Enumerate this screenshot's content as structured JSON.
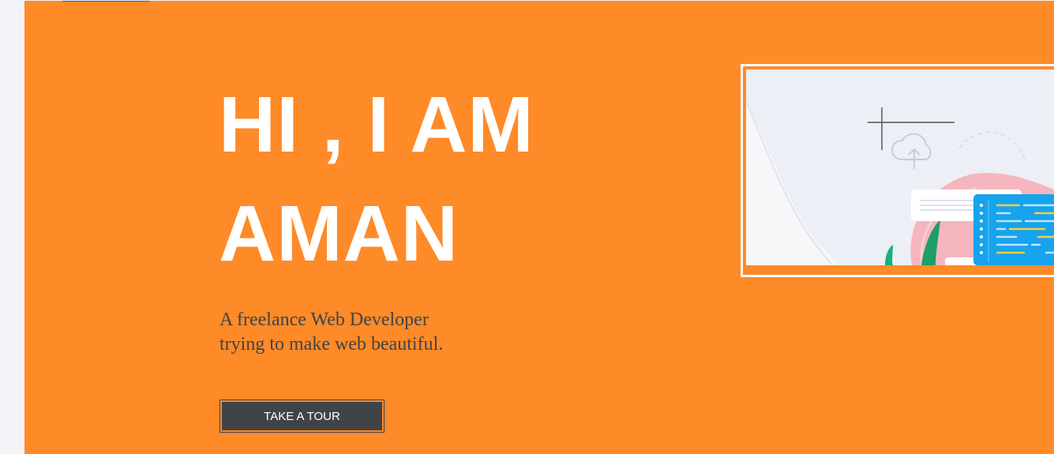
{
  "hero": {
    "headline_line1": "HI , I AM",
    "headline_line2": "AMAN",
    "tagline_line1": "A freelance Web Developer",
    "tagline_line2": "trying to make web beautiful.",
    "cta_label": "TAKE A TOUR"
  },
  "colors": {
    "background": "#fe8a28",
    "headline": "#ffffff",
    "tagline": "#404447",
    "button": "#3f4446",
    "page": "#f3f3f8"
  },
  "illustration": {
    "icon": "web-developer-illustration",
    "elements": [
      "upload-cloud-icon",
      "code-window",
      "plant",
      "crop-marks"
    ]
  }
}
